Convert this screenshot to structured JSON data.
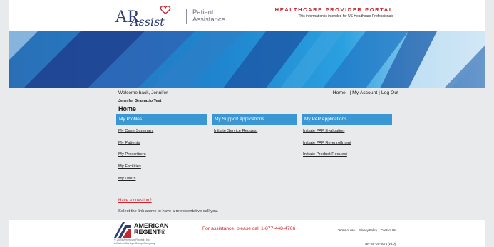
{
  "header": {
    "logo_ar": "AR",
    "logo_assist": "Assist",
    "logo_tagline_1": "Patient",
    "logo_tagline_2": "Assistance",
    "portal_title": "HEALTHCARE PROVIDER PORTAL",
    "portal_subtitle": "This information is intended for US Healthcare Professionals"
  },
  "user": {
    "welcome": "Welcome back, Jennifer",
    "name": "Jennifer Gramazio Test"
  },
  "topnav": {
    "home": "Home",
    "sep": "|",
    "my_account": "My Account",
    "log_out": "Log Out"
  },
  "page_title": "Home",
  "columns": [
    {
      "header": "My Profiles",
      "links": [
        "My Case Summary",
        "My Patients",
        "My Prescribers",
        "My Facilities",
        "My Users"
      ]
    },
    {
      "header": "My Support Applications",
      "links": [
        "Initiate Service Request"
      ]
    },
    {
      "header": "My PAP Applications",
      "links": [
        "Initiate PAP Evaluation",
        "Initiate PAP Re-enrollment",
        "Initiate Product Request"
      ]
    }
  ],
  "help": {
    "question": "Have a question?",
    "note": "Select the link above to have a representative call you."
  },
  "footer": {
    "company_line1": "AMERICAN",
    "company_line2": "REGENT®",
    "copyright": "© 2025 American Regent, Inc.",
    "parent": "A Daiichi Sankyo Group Company",
    "assistance": "For assistance, please call 1-877-448-4766",
    "terms": "Terms of use",
    "privacy": "Privacy Policy",
    "contact": "Contact Us",
    "doc_code": "NP-VE-US-0075 (v3.0)"
  },
  "colors": {
    "brand_blue": "#3b96d4",
    "alert_red": "#d3232a",
    "navy": "#2f3d73"
  }
}
